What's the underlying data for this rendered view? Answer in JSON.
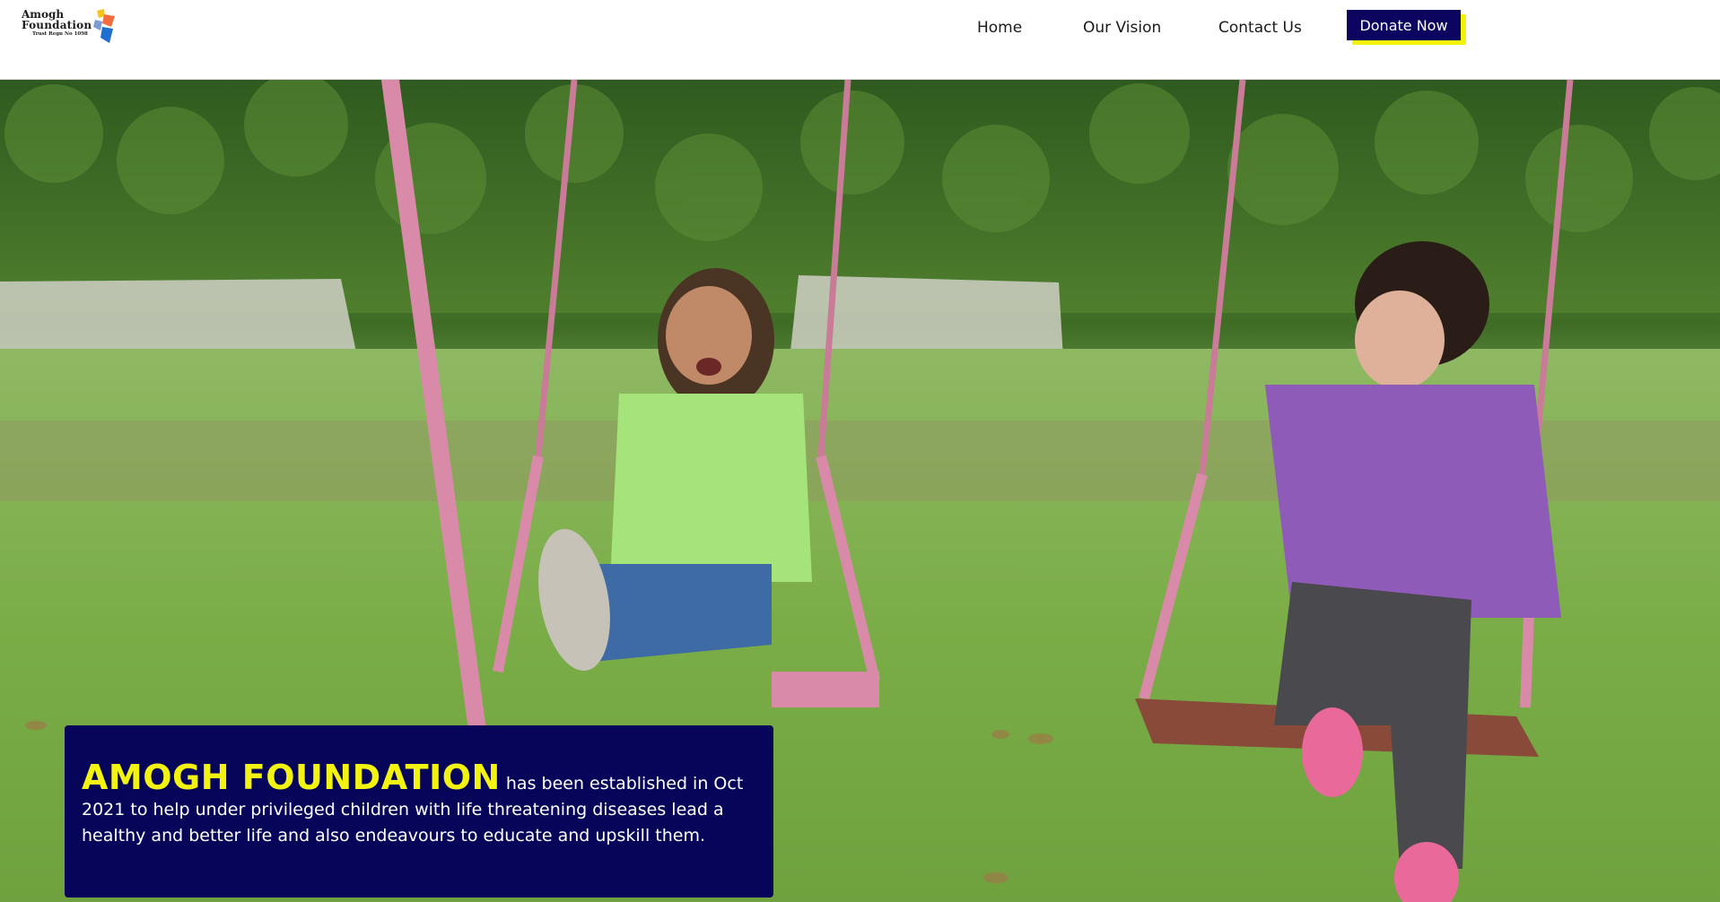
{
  "logo": {
    "line1": "Amogh",
    "line2": "Foundation",
    "line3": "Trust Regn No 1098"
  },
  "nav": {
    "home": "Home",
    "vision": "Our Vision",
    "contact": "Contact Us",
    "donate": "Donate Now"
  },
  "hero": {
    "brand": "AMOGH FOUNDATION",
    "description": " has been established in Oct 2021 to help under privileged children with life threatening diseases lead a healthy and better life and also endeavours to educate and upskill them."
  },
  "colors": {
    "accent_navy": "#07055a",
    "accent_yellow": "#f3f312"
  }
}
